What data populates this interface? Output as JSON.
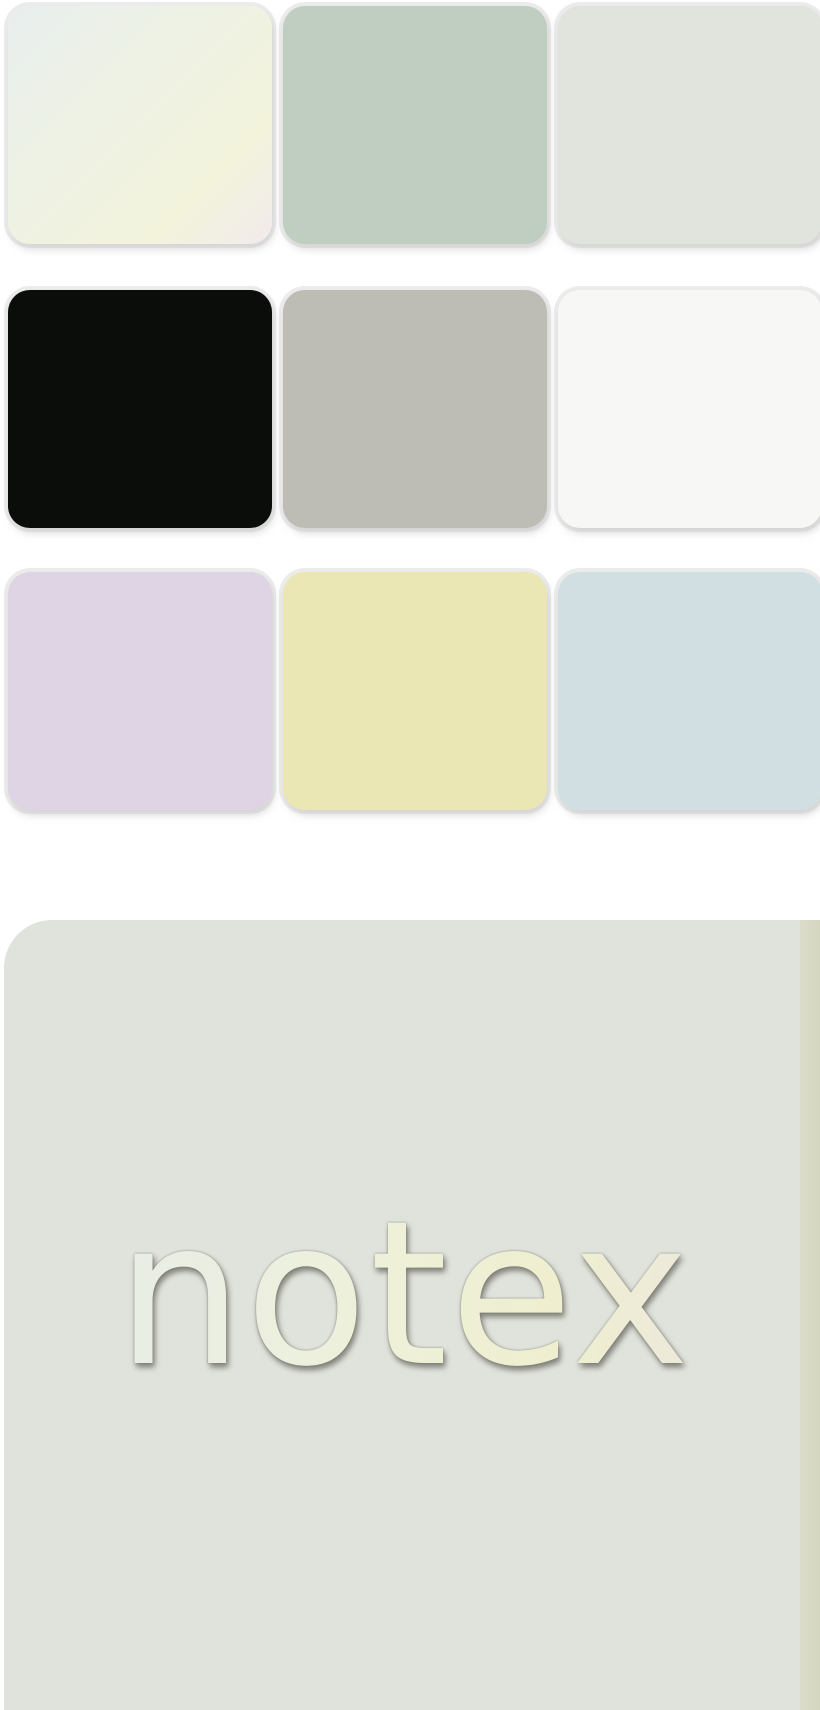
{
  "swatches": [
    {
      "name": "pearl-gradient",
      "color": "#eef1e4"
    },
    {
      "name": "sage",
      "color": "#c0cec2"
    },
    {
      "name": "mist",
      "color": "#e1e4dd"
    },
    {
      "name": "black",
      "color": "#0b0d0b"
    },
    {
      "name": "stone",
      "color": "#bdbdb5"
    },
    {
      "name": "white",
      "color": "#f7f7f6"
    },
    {
      "name": "lavender",
      "color": "#dfd4e4"
    },
    {
      "name": "butter",
      "color": "#ebe7b5"
    },
    {
      "name": "powder-blue",
      "color": "#d1dfe3"
    }
  ],
  "app_icon": {
    "wordmark": "notex",
    "background_color": "#e0e3dc"
  }
}
